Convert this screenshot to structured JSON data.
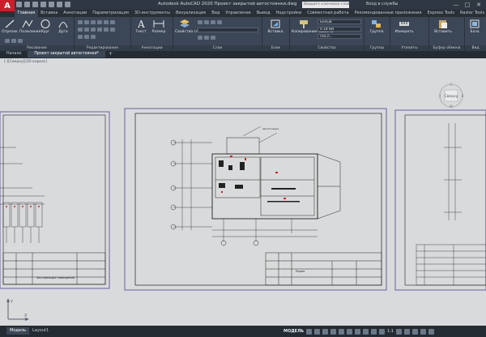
{
  "titlebar": {
    "logo": "A",
    "title": "Autodesk AutoCAD 2020  Проект закрытой автостоянки.dwg",
    "search_placeholder": "Введите ключевое слово/фразу",
    "signin": "Вход в службы",
    "minimize": "—",
    "maximize": "□",
    "close": "✕"
  },
  "ribbon_tabs": [
    "Главная",
    "Вставка",
    "Аннотации",
    "Параметризация",
    "3D-инструменты",
    "Визуализация",
    "Вид",
    "Управление",
    "Вывод",
    "Надстройки",
    "Совместная работа",
    "Рекомендованные приложения",
    "Express Tools",
    "Raster Tools"
  ],
  "ribbon": {
    "draw": {
      "title": "Рисование",
      "tools": [
        "Отрезок",
        "Полилиния",
        "Круг",
        "Дуга"
      ]
    },
    "modify": {
      "title": "Редактирование"
    },
    "annotation": {
      "title": "Аннотации",
      "tools": [
        "Текст",
        "Размер"
      ]
    },
    "layers": {
      "title": "Слои",
      "tools": [
        "Свойства слоя"
      ]
    },
    "block": {
      "title": "Блок",
      "tools": [
        "Вставка"
      ]
    },
    "properties": {
      "title": "Свойства",
      "tools": [
        "Копирование свойств"
      ],
      "color": "Белый",
      "lineweight": "0.18 мм",
      "linetype": "ПоСл..."
    },
    "groups": {
      "title": "Группы",
      "tools": [
        "Группа"
      ]
    },
    "utilities": {
      "title": "Утилиты",
      "tools": [
        "Измерить"
      ]
    },
    "clipboard": {
      "title": "Буфер обмена",
      "tools": [
        "Вставить"
      ]
    },
    "view": {
      "title": "Вид",
      "tools": [
        "База"
      ]
    }
  },
  "filetabs": [
    "Начало",
    "Проект закрытой автостоянки*"
  ],
  "viewport": {
    "label": "[-][Сверху][2D-каркас]",
    "viewcube_face": "Сверху",
    "viewcube_n": "С",
    "viewcube_s": "Ю",
    "viewcube_w": "З",
    "viewcube_e": "В",
    "sheet_texts": [
      "Экспликация помещений",
      "Автостоянка",
      "Разрез"
    ]
  },
  "ucs": {
    "x": "X",
    "y": "Y"
  },
  "model_tabs": [
    "Модель",
    "Layout1"
  ],
  "statusbar": {
    "model": "МОДЕЛЬ",
    "scale": "1:1"
  }
}
